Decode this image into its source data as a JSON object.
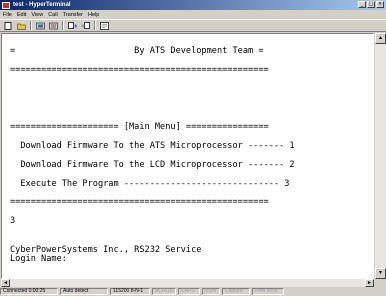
{
  "window": {
    "title": "test - HyperTerminal",
    "minimize": "_",
    "maximize": "□",
    "close": "×"
  },
  "menu": [
    "File",
    "Edit",
    "View",
    "Call",
    "Transfer",
    "Help"
  ],
  "toolbar": {
    "icons": [
      "new-connection-icon",
      "open-icon",
      "disconnect-icon",
      "dial-icon",
      "send-icon",
      "receive-icon",
      "properties-icon"
    ]
  },
  "terminal": {
    "lines": [
      "",
      "=                       By ATS Development Team =",
      "",
      "==================================================",
      "",
      "",
      "",
      "",
      "",
      "===================== [Main Menu] ================",
      "",
      "  Download Firmware To the ATS Microprocessor ------- 1",
      "",
      "  Download Firmware To the LCD Microprocessor ------- 2",
      "",
      "  Execute The Program ------------------------------ 3",
      "",
      "==================================================",
      "",
      "3",
      "",
      "",
      "CyberPowerSystems Inc., RS232 Service",
      "Login Name:"
    ]
  },
  "scroll": {
    "up": "▲",
    "down": "▼",
    "left": "◄",
    "right": "►"
  },
  "status": {
    "connected": "Connected 0:00:25",
    "detect": "Auto detect",
    "settings": "115200 8-N-1",
    "scroll": "SCROLL",
    "caps": "CAPS",
    "num": "NUM",
    "capture": "Capture",
    "print_echo": "Print echo"
  }
}
